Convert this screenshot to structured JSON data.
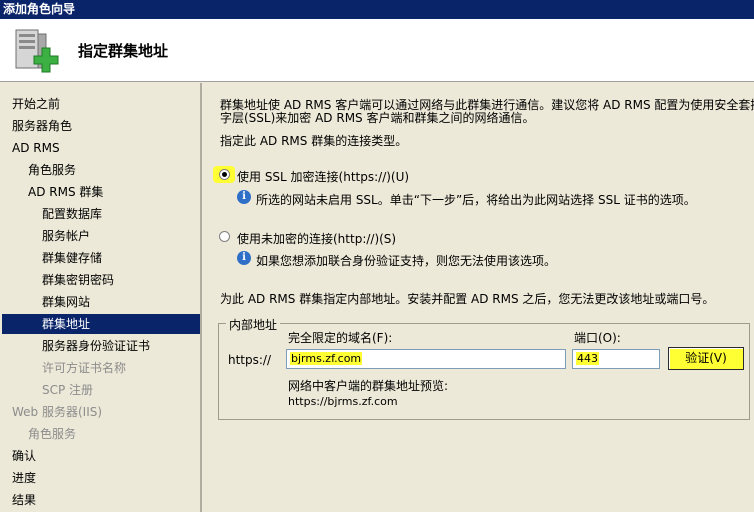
{
  "window": {
    "title": "添加角色向导"
  },
  "header": {
    "icon": "server-add-icon",
    "title": "指定群集地址"
  },
  "sidebar": {
    "items": [
      {
        "label": "开始之前",
        "level": 0,
        "state": "normal"
      },
      {
        "label": "服务器角色",
        "level": 0,
        "state": "normal"
      },
      {
        "label": "AD RMS",
        "level": 0,
        "state": "normal"
      },
      {
        "label": "角色服务",
        "level": 1,
        "state": "normal"
      },
      {
        "label": "AD RMS 群集",
        "level": 1,
        "state": "normal"
      },
      {
        "label": "配置数据库",
        "level": 2,
        "state": "normal"
      },
      {
        "label": "服务帐户",
        "level": 2,
        "state": "normal"
      },
      {
        "label": "群集健存储",
        "level": 2,
        "state": "normal"
      },
      {
        "label": "群集密钥密码",
        "level": 2,
        "state": "normal"
      },
      {
        "label": "群集网站",
        "level": 2,
        "state": "normal"
      },
      {
        "label": "群集地址",
        "level": 2,
        "state": "active"
      },
      {
        "label": "服务器身份验证证书",
        "level": 2,
        "state": "normal"
      },
      {
        "label": "许可方证书名称",
        "level": 2,
        "state": "disabled"
      },
      {
        "label": "SCP 注册",
        "level": 2,
        "state": "disabled"
      },
      {
        "label": "Web 服务器(IIS)",
        "level": 0,
        "state": "disabled"
      },
      {
        "label": "角色服务",
        "level": 1,
        "state": "disabled"
      },
      {
        "label": "确认",
        "level": 0,
        "state": "normal"
      },
      {
        "label": "进度",
        "level": 0,
        "state": "normal"
      },
      {
        "label": "结果",
        "level": 0,
        "state": "normal"
      }
    ]
  },
  "main": {
    "intro_line1": "群集地址使 AD RMS 客户端可以通过网络与此群集进行通信。建议您将 AD RMS 配置为使用安全套接",
    "intro_line2": "字层(SSL)来加密 AD RMS 客户端和群集之间的网络通信。",
    "connection_prompt": "指定此 AD RMS 群集的连接类型。",
    "option_ssl": {
      "label": "使用 SSL 加密连接(https://)(U)",
      "selected": true
    },
    "ssl_info": "所选的网站未启用 SSL。单击“下一步”后，将给出为此网站选择 SSL 证书的选项。",
    "option_plain": {
      "label": "使用未加密的连接(http://)(S)",
      "selected": false
    },
    "plain_info": "如果您想添加联合身份验证支持，则您无法使用该选项。",
    "address_prompt": "为此 AD RMS 群集指定内部地址。安装并配置 AD RMS 之后，您无法更改该地址或端口号。",
    "internal": {
      "legend": "内部地址",
      "fqdn_label": "完全限定的域名(F):",
      "port_label": "端口(O):",
      "scheme": "https://",
      "fqdn_value": "bjrms.zf.com",
      "port_value": "443",
      "verify_label": "验证(V)",
      "preview_label": "网络中客户端的群集地址预览:",
      "preview_value": "https://bjrms.zf.com"
    }
  },
  "colors": {
    "titlebar": "#0a246a",
    "selection": "#0a246a",
    "highlight": "#ffff33",
    "panel": "#ece9d8"
  }
}
